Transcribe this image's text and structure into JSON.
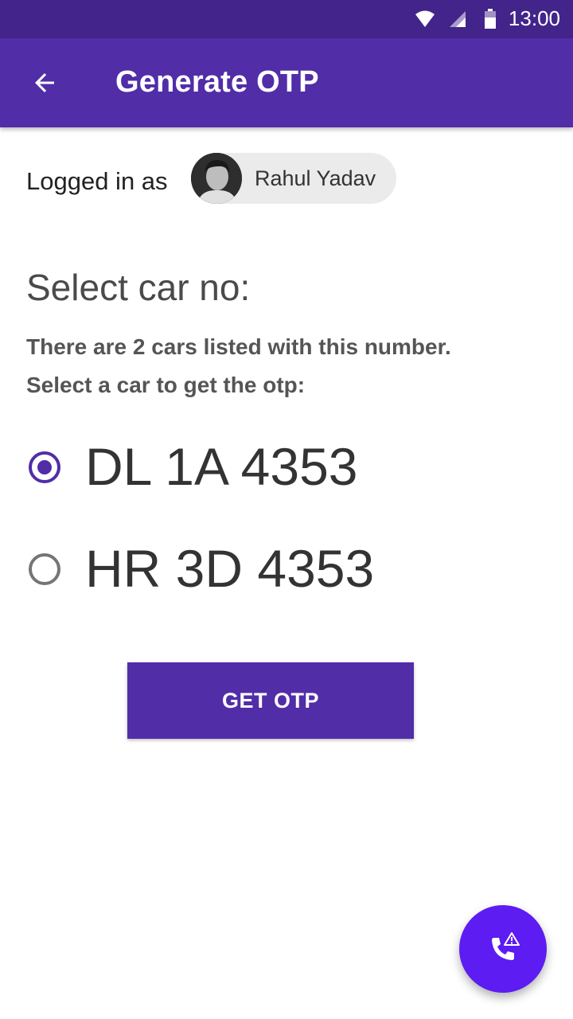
{
  "status_bar": {
    "time": "13:00",
    "icons": [
      "wifi-icon",
      "signal-icon",
      "battery-icon"
    ]
  },
  "app_bar": {
    "title": "Generate OTP",
    "back_icon": "arrow-back-icon"
  },
  "user": {
    "label": "Logged in as",
    "name": "Rahul Yadav"
  },
  "selection": {
    "title": "Select car no:",
    "description_line1": "There are 2 cars listed with this number.",
    "description_line2": "Select a car to get the otp:",
    "options": [
      {
        "label": "DL 1A 4353",
        "selected": true
      },
      {
        "label": "HR 3D 4353",
        "selected": false
      }
    ]
  },
  "actions": {
    "get_otp_label": "GET OTP",
    "fab_icon": "phone-alert-icon"
  },
  "colors": {
    "primary": "#512da8",
    "status_bar": "#42248a",
    "fab": "#5c1cf2"
  }
}
